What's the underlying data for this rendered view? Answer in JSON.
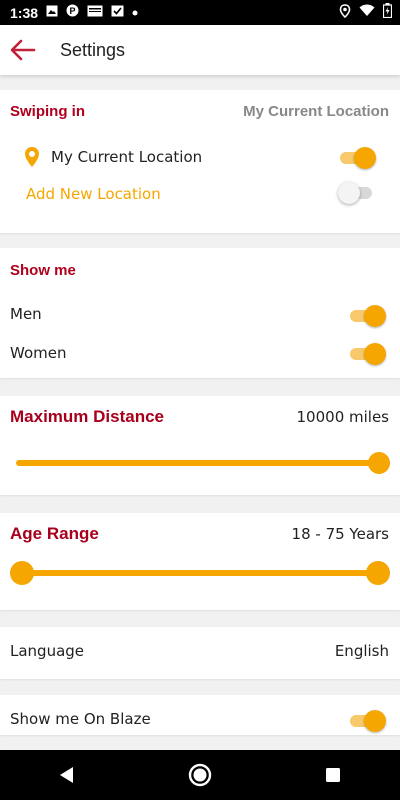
{
  "status_bar": {
    "time": "1:38",
    "left_icons": [
      "image-icon",
      "pinterest-icon",
      "news-icon",
      "calendar-icon",
      "dot-icon"
    ],
    "right_icons": [
      "location-icon",
      "wifi-icon",
      "battery-icon"
    ]
  },
  "app_bar": {
    "back_icon": "arrow-back-icon",
    "title": "Settings",
    "accent_color": "#c0203a"
  },
  "swiping": {
    "title": "Swiping in",
    "current_value": "My Current Location",
    "location_label": "My Current Location",
    "location_toggle": true,
    "add_location_label": "Add New Location",
    "add_location_toggle": false
  },
  "show_me": {
    "title": "Show me",
    "options": [
      {
        "label": "Men",
        "enabled": true
      },
      {
        "label": "Women",
        "enabled": true
      }
    ]
  },
  "max_distance": {
    "title": "Maximum Distance",
    "value_text": "10000 miles",
    "fraction": 1.0
  },
  "age_range": {
    "title": "Age Range",
    "value_text": "18 - 75 Years",
    "min_fraction": 0.0,
    "max_fraction": 1.0
  },
  "language": {
    "label": "Language",
    "value": "English"
  },
  "show_on_blaze": {
    "label": "Show me On Blaze",
    "enabled": true
  },
  "colors": {
    "accent": "#f5a600",
    "section_title": "#b0001e"
  },
  "nav": [
    "back-triangle-icon",
    "home-circle-icon",
    "recents-square-icon"
  ]
}
